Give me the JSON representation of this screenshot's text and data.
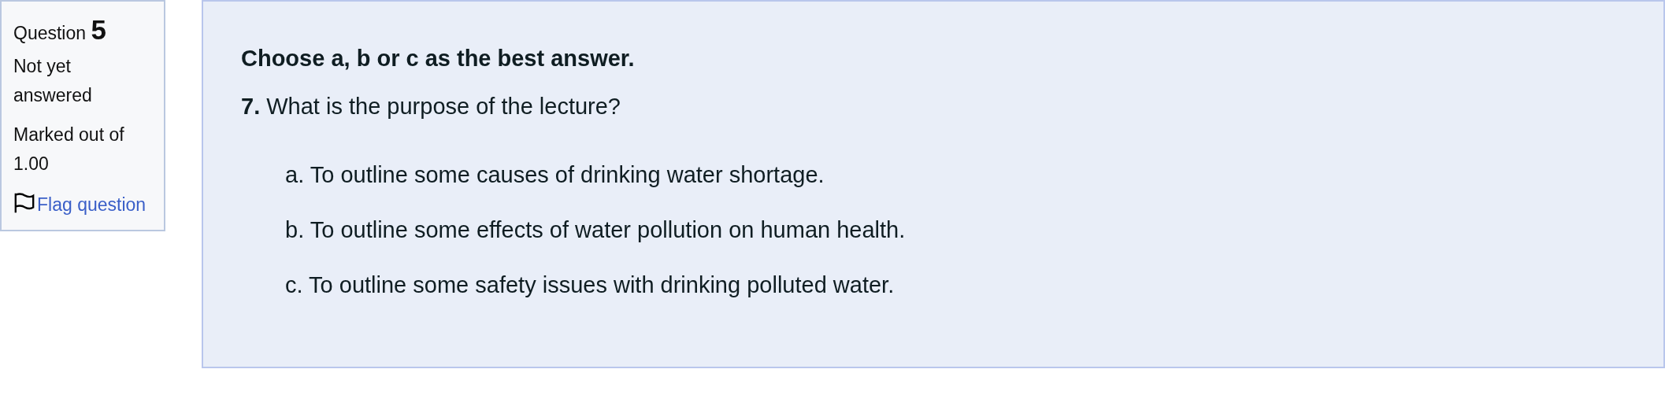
{
  "info": {
    "label": "Question",
    "number": "5",
    "state": "Not yet answered",
    "marks": "Marked out of 1.00",
    "flag": {
      "label": "Flag question",
      "flagged": false
    }
  },
  "question": {
    "instruction": "Choose a, b or c as the best answer.",
    "prompt": "**7.** What is the purpose of the lecture?",
    "options": [
      {
        "label": "a. To outline some causes of drinking water shortage."
      },
      {
        "label": "b. To outline some effects of water pollution on human health."
      },
      {
        "label": "c. To outline some safety issues with drinking polluted water."
      }
    ]
  }
}
